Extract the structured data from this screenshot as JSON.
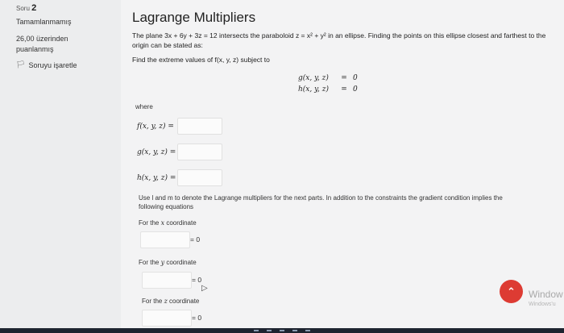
{
  "sidebar": {
    "question_prefix": "Soru",
    "question_number": "2",
    "status": "Tamamlanmamış",
    "points": "26,00 üzerinden puanlanmış",
    "flag_label": "Soruyu işaretle"
  },
  "main": {
    "title": "Lagrange Multipliers",
    "intro": "The plane 3x + 6y + 3z = 12 intersects the paraboloid z = x² + y² in an ellipse. Finding the points on this ellipse closest and farthest to the origin can be stated as:",
    "find_text": "Find the extreme values of f(x, y, z) subject to",
    "system": [
      {
        "lhs": "g(x, y, z)",
        "eq": "=",
        "rhs": "0"
      },
      {
        "lhs": "h(x, y, z)",
        "eq": "=",
        "rhs": "0"
      }
    ],
    "where": "where",
    "fields": [
      {
        "label": "f(x, y, z) =",
        "value": ""
      },
      {
        "label": "g(x, y, z) =",
        "value": ""
      },
      {
        "label": "h(x, y, z) =",
        "value": ""
      }
    ],
    "note": "Use l and m to denote the Lagrange multipliers for the next parts. In addition to the constraints the gradient condition implies the following equations",
    "coords": [
      {
        "prefix": "For the ",
        "var": "x",
        "suffix": " coordinate",
        "eq": "= 0"
      },
      {
        "prefix": "For the ",
        "var": "y",
        "suffix": " coordinate",
        "eq": "= 0"
      },
      {
        "prefix": "For the ",
        "var": "z",
        "suffix": " coordinate",
        "eq": "= 0"
      }
    ]
  },
  "watermark": {
    "line1": "Window",
    "line2": "Windows'u"
  },
  "scroll_button_icon": "chevron-up-icon",
  "colors": {
    "accent": "#dd3b33",
    "background": "#ecedee"
  }
}
